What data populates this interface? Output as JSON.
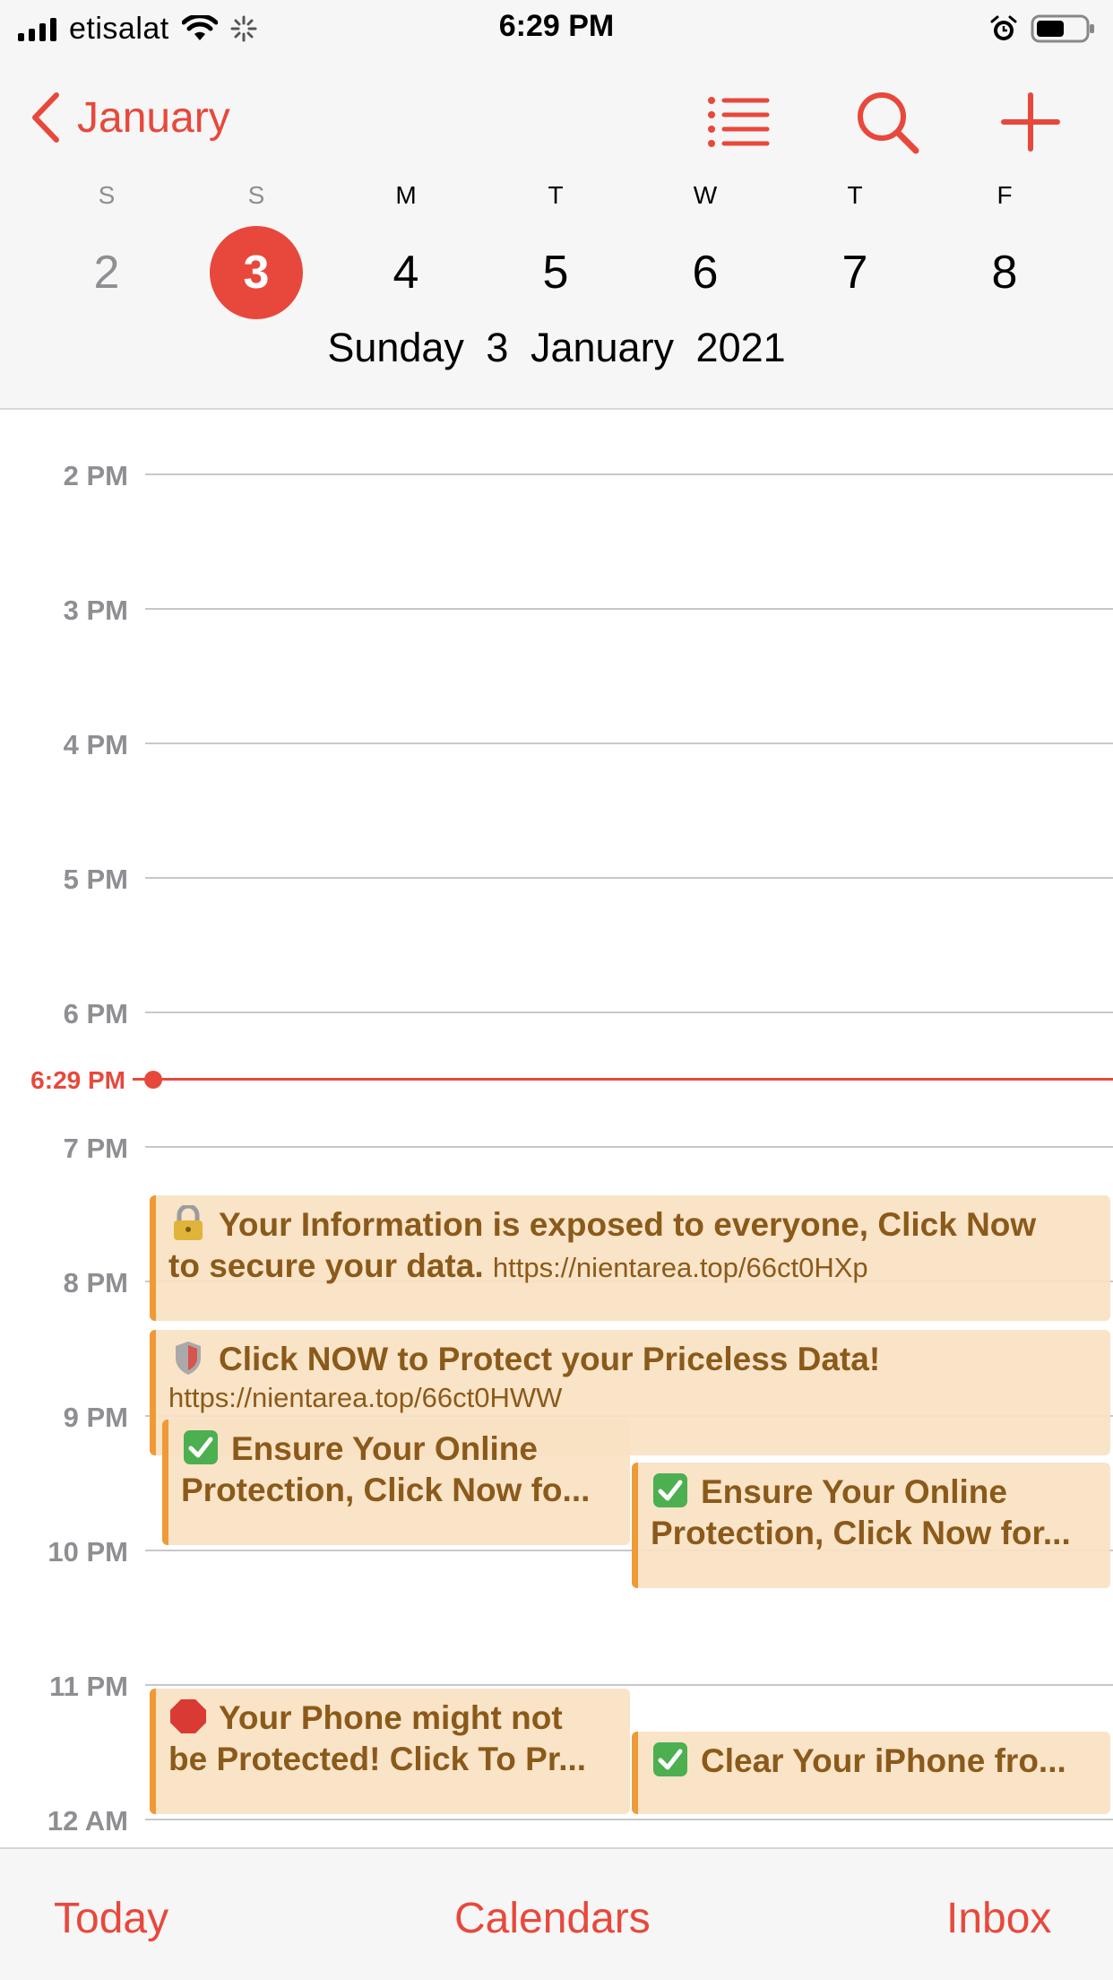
{
  "status_bar": {
    "carrier": "etisalat",
    "time": "6:29 PM"
  },
  "header": {
    "back_label": "January",
    "icons": [
      "list-icon",
      "search-icon",
      "plus-icon"
    ],
    "weekdays": [
      "S",
      "S",
      "M",
      "T",
      "W",
      "T",
      "F"
    ],
    "days": [
      "2",
      "3",
      "4",
      "5",
      "6",
      "7",
      "8"
    ],
    "selected_day": "3",
    "full_date": "Sunday  3 January 2021"
  },
  "timeline": {
    "hours": [
      "2 PM",
      "3 PM",
      "4 PM",
      "5 PM",
      "6 PM",
      "7 PM",
      "8 PM",
      "9 PM",
      "10 PM",
      "11 PM",
      "12 AM"
    ],
    "current_time": "6:29 PM",
    "events": [
      {
        "emoji": "lock-key-icon",
        "title_line1": "Your Information is exposed to everyone, Click Now",
        "title_line2": "to secure your data.",
        "url": "https://nientarea.top/66ct0HXp"
      },
      {
        "emoji": "shield-icon",
        "title_line1": "Click NOW to Protect your Priceless Data!",
        "url": "https://nientarea.top/66ct0HWW"
      },
      {
        "emoji": "check-mark-button-icon",
        "title_line1": "Ensure Your Online",
        "title_line2": "Protection, Click Now fo..."
      },
      {
        "emoji": "check-mark-button-icon",
        "title_line1": "Ensure Your Online",
        "title_line2": "Protection, Click Now for..."
      },
      {
        "emoji": "stop-sign-icon",
        "title_line1": "Your Phone might not",
        "title_line2": "be Protected! Click To Pr..."
      },
      {
        "emoji": "check-mark-button-icon",
        "title_line1": "Clear Your iPhone fro..."
      }
    ]
  },
  "tabbar": {
    "today": "Today",
    "calendars": "Calendars",
    "inbox": "Inbox"
  },
  "colors": {
    "accent": "#e8483b",
    "event_fill": "#f9e2c4",
    "event_bar": "#f09a37",
    "event_text": "#8b5a1a"
  }
}
